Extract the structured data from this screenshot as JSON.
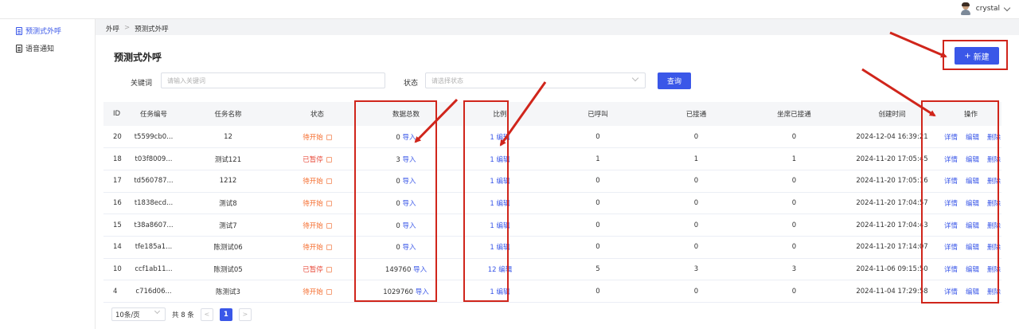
{
  "user": {
    "name": "crystal"
  },
  "sidebar": {
    "items": [
      {
        "label": "预测式外呼",
        "active": true
      },
      {
        "label": "语音通知",
        "active": false
      }
    ]
  },
  "breadcrumb": [
    "外呼",
    "预测式外呼"
  ],
  "page": {
    "title": "预测式外呼",
    "new_button": "新建",
    "new_icon": "+"
  },
  "filters": {
    "keyword_label": "关键词",
    "keyword_placeholder": "请输入关键词",
    "status_label": "状态",
    "status_placeholder": "请选择状态",
    "query_button": "查询"
  },
  "table": {
    "columns": [
      "ID",
      "任务编号",
      "任务名称",
      "状态",
      "数据总数",
      "比例",
      "已呼叫",
      "已接通",
      "坐席已接通",
      "创建时间",
      "操作"
    ],
    "import_label": "导入",
    "edit_label": "编辑",
    "ops": [
      "详情",
      "编辑",
      "删除"
    ],
    "rows": [
      {
        "id": "20",
        "code": "t5599cb0...",
        "name": "12",
        "status": "待开始",
        "status_type": "wait",
        "total": "0",
        "ratio": "1",
        "called": "0",
        "connected": "0",
        "agent": "0",
        "time": "2024-12-04 16:39:21"
      },
      {
        "id": "18",
        "code": "t03f8009...",
        "name": "测试121",
        "status": "已暂停",
        "status_type": "pause",
        "total": "3",
        "ratio": "1",
        "called": "1",
        "connected": "1",
        "agent": "1",
        "time": "2024-11-20 17:05:45"
      },
      {
        "id": "17",
        "code": "td560787...",
        "name": "1212",
        "status": "待开始",
        "status_type": "wait",
        "total": "0",
        "ratio": "1",
        "called": "0",
        "connected": "0",
        "agent": "0",
        "time": "2024-11-20 17:05:16"
      },
      {
        "id": "16",
        "code": "t1838ecd...",
        "name": "测试8",
        "status": "待开始",
        "status_type": "wait",
        "total": "0",
        "ratio": "1",
        "called": "0",
        "connected": "0",
        "agent": "0",
        "time": "2024-11-20 17:04:57"
      },
      {
        "id": "15",
        "code": "t38a8607...",
        "name": "测试7",
        "status": "待开始",
        "status_type": "wait",
        "total": "0",
        "ratio": "1",
        "called": "0",
        "connected": "0",
        "agent": "0",
        "time": "2024-11-20 17:04:43"
      },
      {
        "id": "14",
        "code": "tfe185a1...",
        "name": "陈测试06",
        "status": "待开始",
        "status_type": "wait",
        "total": "0",
        "ratio": "1",
        "called": "0",
        "connected": "0",
        "agent": "0",
        "time": "2024-11-20 17:14:07"
      },
      {
        "id": "10",
        "code": "ccf1ab11...",
        "name": "陈测试05",
        "status": "已暂停",
        "status_type": "pause",
        "total": "149760",
        "ratio": "12",
        "called": "5",
        "connected": "3",
        "agent": "3",
        "time": "2024-11-06 09:15:50"
      },
      {
        "id": "4",
        "code": "c716d06...",
        "name": "陈测试3",
        "status": "待开始",
        "status_type": "wait",
        "total": "1029760",
        "ratio": "1",
        "called": "0",
        "connected": "0",
        "agent": "0",
        "time": "2024-11-04 17:29:58"
      }
    ]
  },
  "pagination": {
    "page_size": "10条/页",
    "total": "共 8 条",
    "current": "1",
    "prev": "<",
    "next": ">"
  },
  "colors": {
    "primary": "#3a57e8",
    "wait": "#f56c2d",
    "pause": "#e84a3a",
    "annotation": "#d0251b"
  }
}
